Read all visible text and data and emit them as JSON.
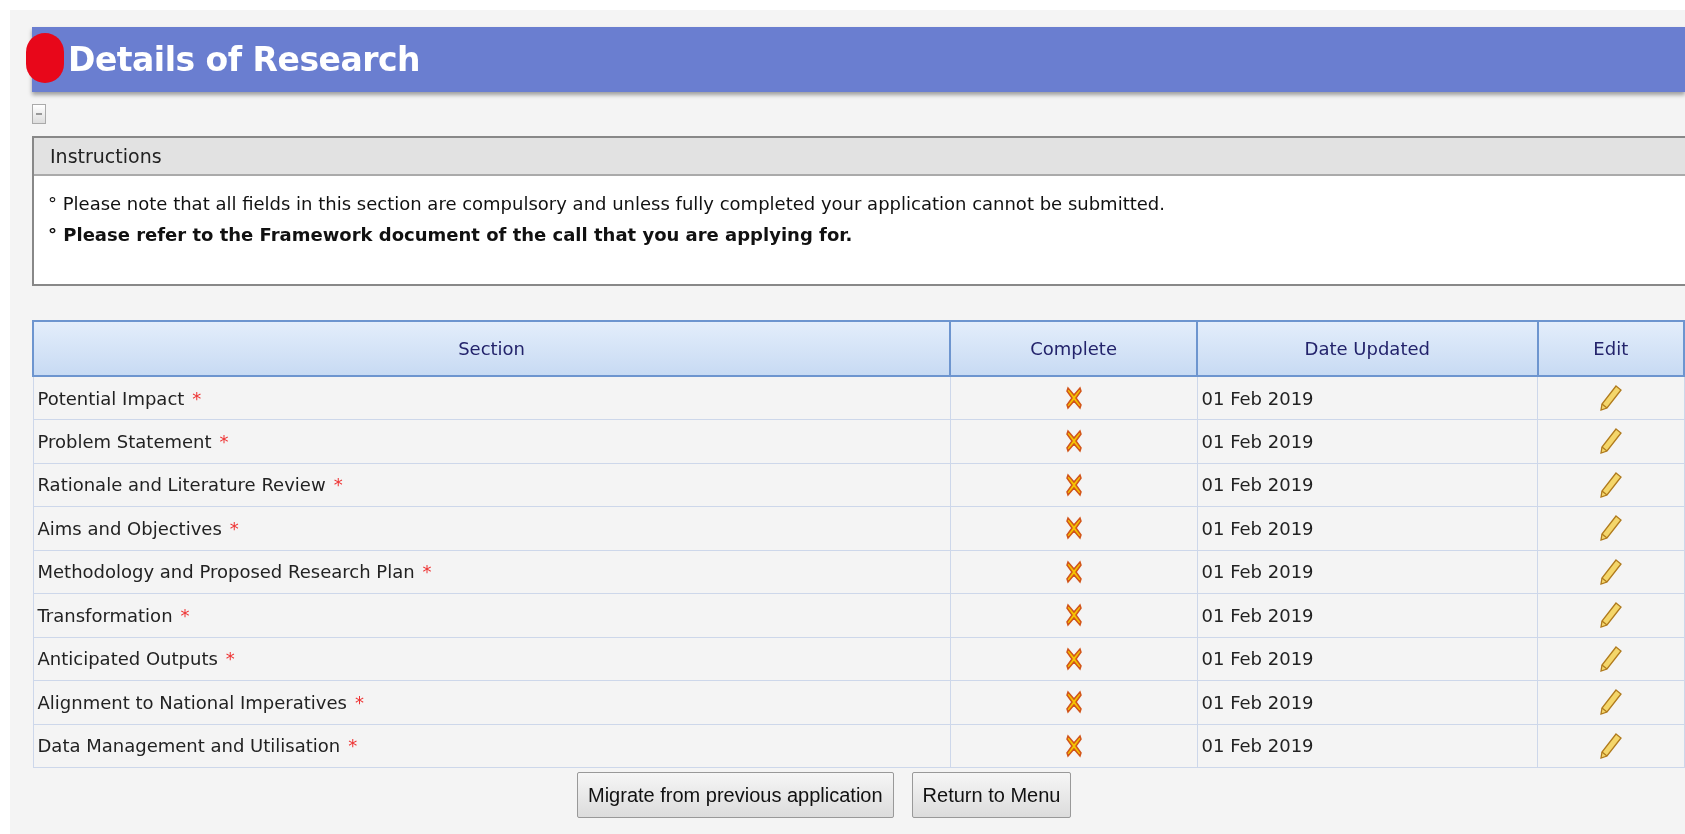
{
  "header": {
    "title": "Details of Research"
  },
  "collapse": {
    "expanded": true
  },
  "instructions": {
    "title": "Instructions",
    "items": [
      {
        "text": "° Please note that all fields in this section are compulsory and unless fully completed your application cannot be submitted.",
        "emphasis": false
      },
      {
        "text": "° Please refer to the Framework document of the call that you are applying for.",
        "emphasis": true
      }
    ]
  },
  "table": {
    "columns": [
      "Section",
      "Complete",
      "Date Updated",
      "Edit"
    ],
    "rows": [
      {
        "section": "Potential Impact",
        "required": true,
        "complete": false,
        "date": "01 Feb 2019"
      },
      {
        "section": "Problem Statement",
        "required": true,
        "complete": false,
        "date": "01 Feb 2019"
      },
      {
        "section": "Rationale and Literature Review",
        "required": true,
        "complete": false,
        "date": "01 Feb 2019"
      },
      {
        "section": "Aims and Objectives",
        "required": true,
        "complete": false,
        "date": "01 Feb 2019"
      },
      {
        "section": "Methodology and Proposed Research Plan",
        "required": true,
        "complete": false,
        "date": "01 Feb 2019"
      },
      {
        "section": "Transformation",
        "required": true,
        "complete": false,
        "date": "01 Feb 2019"
      },
      {
        "section": "Anticipated Outputs",
        "required": true,
        "complete": false,
        "date": "01 Feb 2019"
      },
      {
        "section": "Alignment to National Imperatives",
        "required": true,
        "complete": false,
        "date": "01 Feb 2019"
      },
      {
        "section": "Data Management and Utilisation",
        "required": true,
        "complete": false,
        "date": "01 Feb 2019"
      }
    ]
  },
  "required_mark": "*",
  "buttons": [
    "Migrate from previous application",
    "Return to Menu"
  ]
}
